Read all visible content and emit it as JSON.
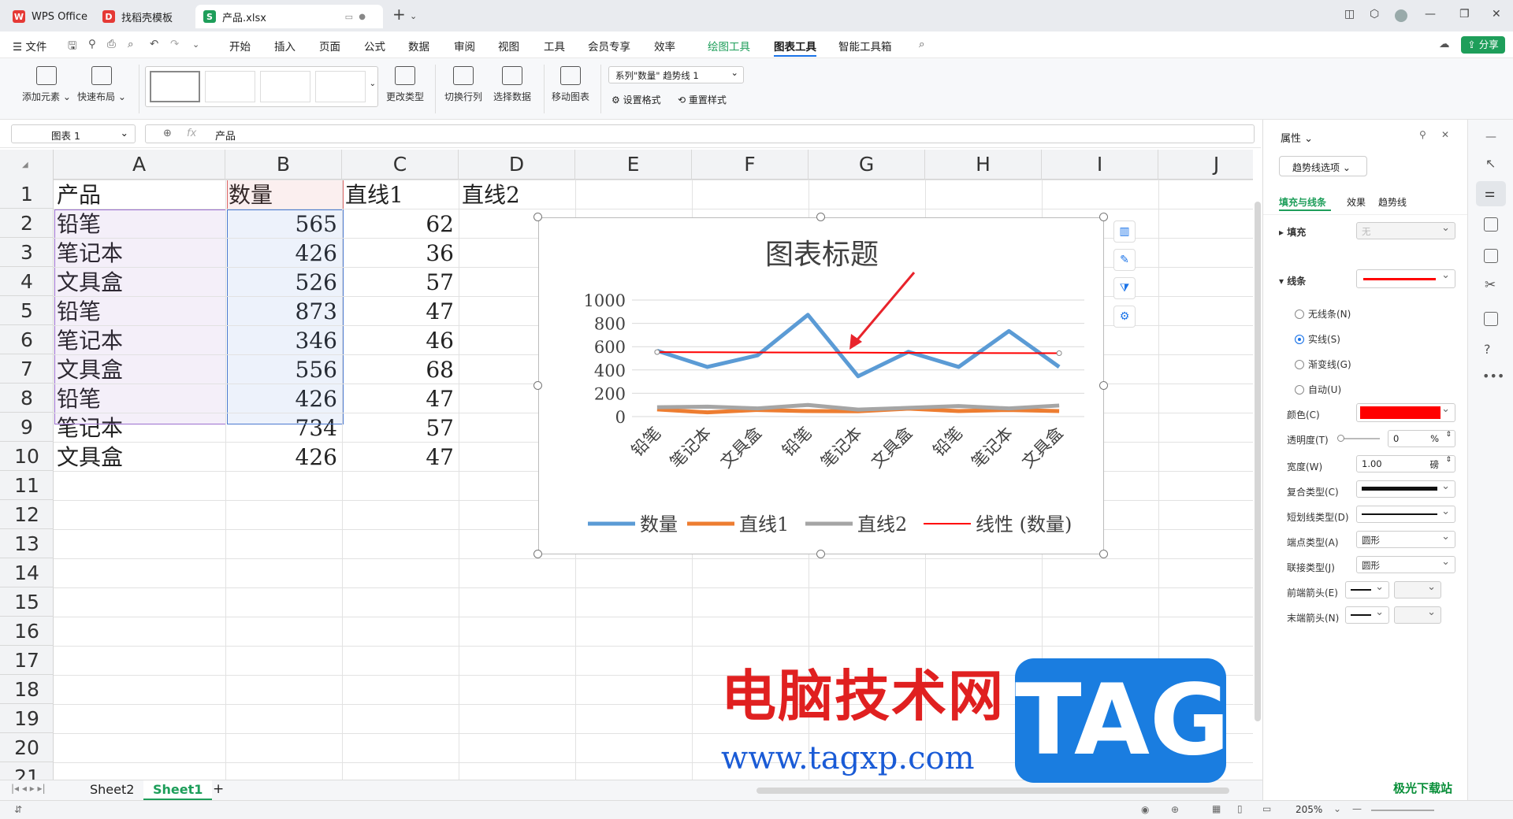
{
  "tabs": [
    {
      "label": "WPS Office",
      "icon": "wps-icon"
    },
    {
      "label": "找稻壳模板",
      "icon": "docer-icon"
    },
    {
      "label": "产品.xlsx",
      "icon": "sheet-icon"
    }
  ],
  "menu": {
    "file": "文件",
    "items": [
      "开始",
      "插入",
      "页面",
      "公式",
      "数据",
      "审阅",
      "视图",
      "工具",
      "会员专享",
      "效率",
      "绘图工具",
      "图表工具",
      "智能工具箱"
    ],
    "active": "图表工具",
    "share": "分享"
  },
  "ribbon": {
    "add_element": "添加元素",
    "quick_layout": "快速布局",
    "change_type": "更改类型",
    "switch_row_col": "切换行列",
    "select_data": "选择数据",
    "move_chart": "移动图表",
    "series_select": "系列\"数量\" 趋势线 1",
    "set_format": "设置格式",
    "reset_style": "重置样式"
  },
  "formula": {
    "name_box": "图表 1",
    "fx": "fx",
    "content": "产品"
  },
  "columns": [
    "A",
    "B",
    "C",
    "D",
    "E",
    "F",
    "G",
    "H",
    "I",
    "J"
  ],
  "rows": [
    "1",
    "2",
    "3",
    "4",
    "5",
    "6",
    "7",
    "8",
    "9",
    "10",
    "11",
    "12",
    "13",
    "14",
    "15",
    "16",
    "17",
    "18",
    "19",
    "20",
    "21"
  ],
  "table": {
    "headers": [
      "产品",
      "数量",
      "直线1",
      "直线2"
    ],
    "data": [
      [
        "铅笔",
        "565",
        "62"
      ],
      [
        "笔记本",
        "426",
        "36"
      ],
      [
        "文具盒",
        "526",
        "57"
      ],
      [
        "铅笔",
        "873",
        "47"
      ],
      [
        "笔记本",
        "346",
        "46"
      ],
      [
        "文具盒",
        "556",
        "68"
      ],
      [
        "铅笔",
        "426",
        "47"
      ],
      [
        "笔记本",
        "734",
        "57"
      ],
      [
        "文具盒",
        "426",
        "47"
      ]
    ]
  },
  "chart_data": {
    "type": "line",
    "title": "图表标题",
    "categories": [
      "铅笔",
      "笔记本",
      "文具盒",
      "铅笔",
      "笔记本",
      "文具盒",
      "铅笔",
      "笔记本",
      "文具盒"
    ],
    "series": [
      {
        "name": "数量",
        "values": [
          565,
          426,
          526,
          873,
          346,
          556,
          426,
          734,
          426
        ],
        "color": "#5b9bd5"
      },
      {
        "name": "直线1",
        "values": [
          62,
          36,
          57,
          47,
          46,
          68,
          47,
          57,
          47
        ],
        "color": "#ed7d31"
      },
      {
        "name": "直线2",
        "values": [
          80,
          85,
          70,
          100,
          60,
          75,
          90,
          70,
          95
        ],
        "color": "#a5a5a5"
      },
      {
        "name": "线性 (数量)",
        "values": [
          553,
          552,
          551,
          550,
          549,
          547,
          546,
          545,
          544
        ],
        "color": "#ff0000",
        "trendline": true
      }
    ],
    "yticks": [
      "1000",
      "800",
      "600",
      "400",
      "200",
      "0"
    ],
    "ylim": [
      0,
      1000
    ],
    "grid": true,
    "legend": "bottom"
  },
  "sheets": {
    "items": [
      "Sheet2",
      "Sheet1"
    ],
    "active": "Sheet1"
  },
  "status": {
    "zoom": "205%"
  },
  "panel": {
    "title": "属性",
    "dropdown": "趋势线选项",
    "tabs": [
      "填充与线条",
      "效果",
      "趋势线"
    ],
    "fill_label": "填充",
    "fill_value": "无",
    "line_label": "线条",
    "radios": [
      "无线条(N)",
      "实线(S)",
      "渐变线(G)",
      "自动(U)"
    ],
    "color_label": "颜色(C)",
    "color_value": "#ff0000",
    "transparency_label": "透明度(T)",
    "transparency_value": "0",
    "transparency_unit": "%",
    "width_label": "宽度(W)",
    "width_value": "1.00",
    "width_unit": "磅",
    "compound_label": "复合类型(C)",
    "dash_label": "短划线类型(D)",
    "cap_label": "端点类型(A)",
    "cap_value": "圆形",
    "join_label": "联接类型(J)",
    "join_value": "圆形",
    "start_arrow_label": "前端箭头(E)",
    "end_arrow_label": "末端箭头(N)"
  },
  "watermark": {
    "title": "电脑技术网",
    "url": "www.tagxp.com",
    "tag": "TAG",
    "corner": "极光下载站"
  }
}
